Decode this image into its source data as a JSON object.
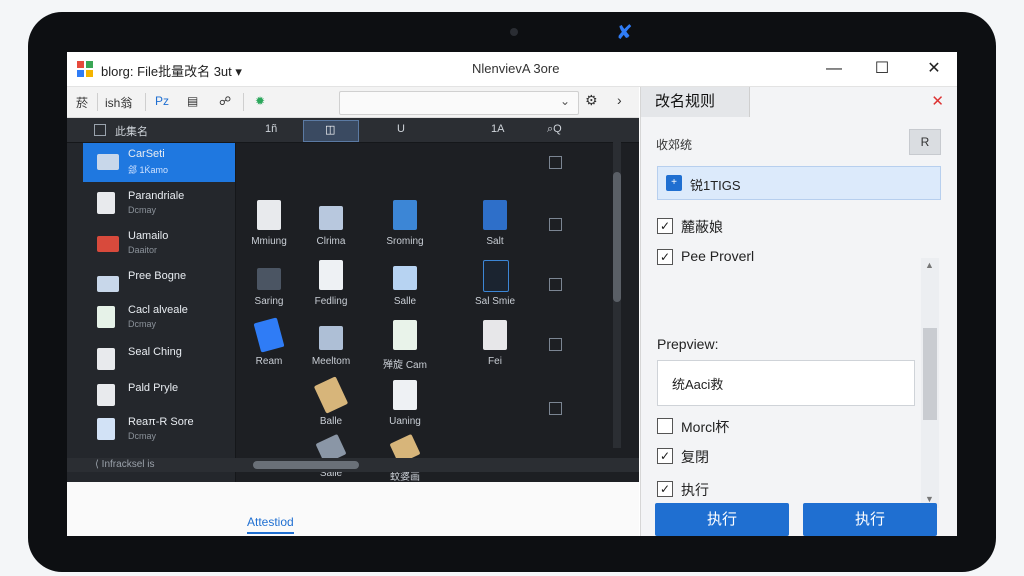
{
  "window": {
    "title": "blorg: File批量改名 3ut",
    "title_dropdown": "▾",
    "center_title": "NlenvievA 3ore"
  },
  "toolbar": {
    "items": [
      "菸",
      "ish翁",
      "Pz",
      "▤",
      "☍",
      "✹"
    ]
  },
  "columns": [
    "1ñ",
    "◫",
    "U",
    "1A",
    "⌕Q"
  ],
  "left_list": {
    "header": "此集名",
    "items": [
      {
        "title": "CarSeti",
        "sub": "郐 1Ḱamo"
      },
      {
        "title": "Parandriale",
        "sub": "Dcmay"
      },
      {
        "title": "Uamailo",
        "sub": "Daaitor"
      },
      {
        "title": "Pree Bogne",
        "sub": ""
      },
      {
        "title": "Cacl alveale",
        "sub": "Dcmay"
      },
      {
        "title": "Seal Ching",
        "sub": ""
      },
      {
        "title": "Pald Pryle",
        "sub": ""
      },
      {
        "title": "Reaπ-R Sore",
        "sub": "Dcmay"
      }
    ],
    "footer": "⟨ Infracksel is"
  },
  "grid": [
    {
      "label": "Mmiung"
    },
    {
      "label": "Clrima"
    },
    {
      "label": "Sroming"
    },
    {
      "label": "Salt"
    },
    {
      "label": "Saring"
    },
    {
      "label": "Fedling"
    },
    {
      "label": "Salle"
    },
    {
      "label": "Sal Smie"
    },
    {
      "label": "Ream"
    },
    {
      "label": "Meeltom"
    },
    {
      "label": "殚旋 Cam"
    },
    {
      "label": "Fei"
    },
    {
      "label": "Balle"
    },
    {
      "label": "Uaning"
    },
    {
      "label": "Salle"
    },
    {
      "label": "蚊婆画"
    }
  ],
  "status": {
    "tab": "Attestiod"
  },
  "rules_panel": {
    "tab": "改名规则",
    "close": "✕",
    "label": "收郊统",
    "side_button": "R",
    "selection_icon": "+",
    "selection": "锐1TIGS",
    "options": [
      {
        "label": "麓蔽娘",
        "checked": true
      },
      {
        "label": "Pee Proverl",
        "checked": true
      }
    ],
    "preview_label": "Prepview:",
    "preview_text": "统Aaci救",
    "options2": [
      {
        "label": "Morcl杯",
        "checked": false
      },
      {
        "label": "复閉",
        "checked": true
      },
      {
        "label": "执行",
        "checked": true
      }
    ],
    "buttons": [
      "执行",
      "执行"
    ]
  },
  "colors": {
    "accent": "#1f6fd1",
    "pane": "#1d1f23",
    "selection": "#1f78e0"
  }
}
